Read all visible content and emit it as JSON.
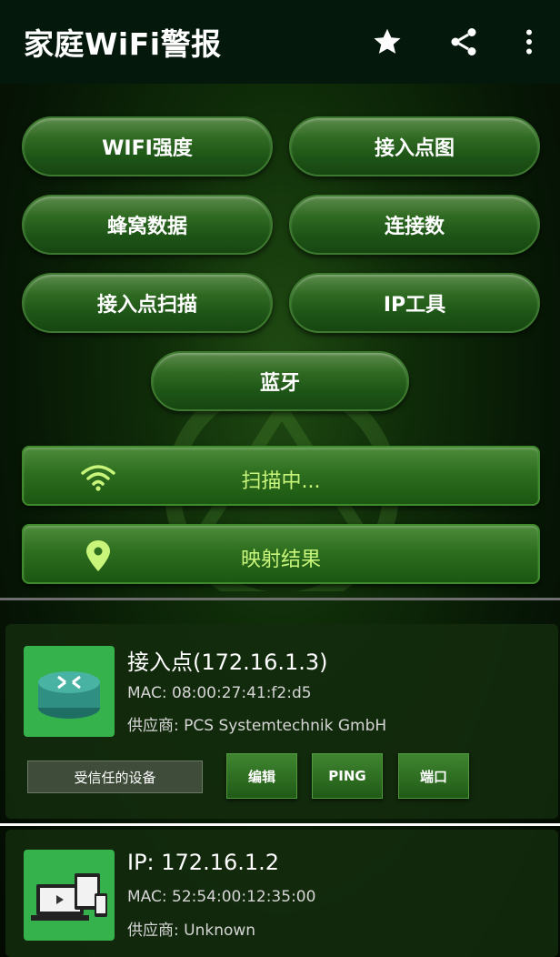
{
  "app_bar": {
    "title": "家庭WiFi警报",
    "icons": [
      "star-icon",
      "share-icon",
      "more-vert-icon"
    ]
  },
  "menu": {
    "wifi_strength": "WIFI强度",
    "ap_map": "接入点图",
    "cellular_data": "蜂窝数据",
    "connections": "连接数",
    "ap_scan": "接入点扫描",
    "ip_tools": "IP工具",
    "bluetooth": "蓝牙"
  },
  "actions": {
    "scanning": "扫描中...",
    "map_results": "映射结果"
  },
  "devices": [
    {
      "title": "接入点(172.16.1.3)",
      "mac": "MAC: 08:00:27:41:f2:d5",
      "vendor": "供应商: PCS Systemtechnik GmbH",
      "icon": "router-icon",
      "buttons": {
        "trusted": "受信任的设备",
        "edit": "编辑",
        "ping": "PING",
        "port": "端口"
      }
    },
    {
      "title": "IP: 172.16.1.2",
      "mac": "MAC:  52:54:00:12:35:00",
      "vendor": "供应商: Unknown",
      "icon": "devices-icon"
    }
  ],
  "colors": {
    "app_bar": "#04180b",
    "button_green": "#2f6a22",
    "accent_text": "#c8f57a",
    "device_icon_bg": "#35b24b"
  }
}
